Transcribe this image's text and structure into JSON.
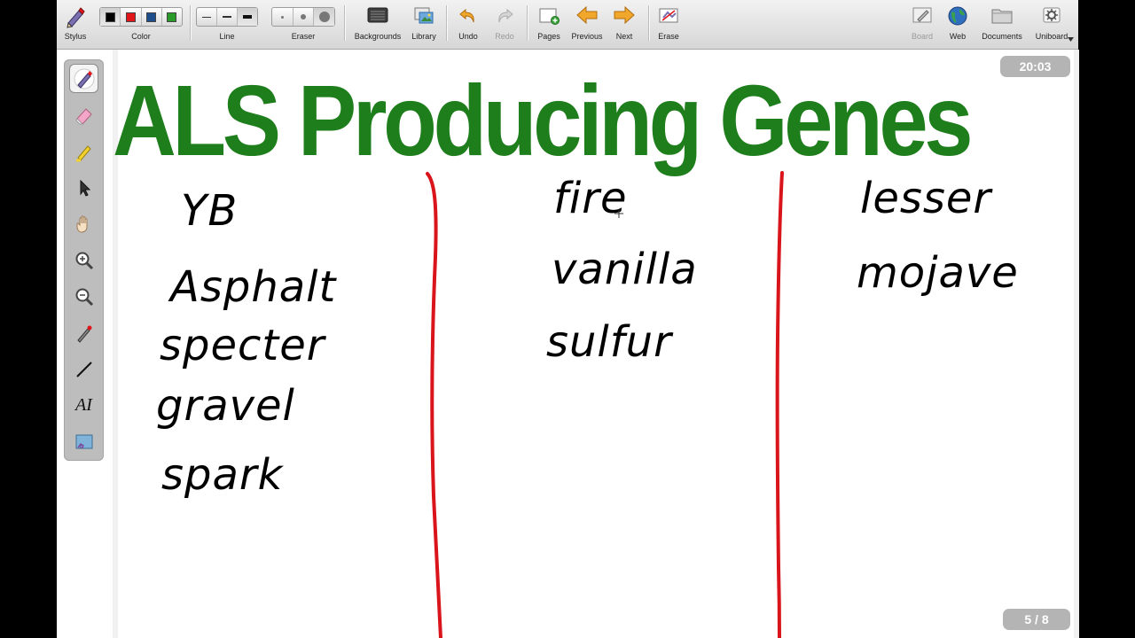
{
  "toolbar": {
    "stylus_label": "Stylus",
    "color_label": "Color",
    "line_label": "Line",
    "eraser_label": "Eraser",
    "backgrounds_label": "Backgrounds",
    "library_label": "Library",
    "undo_label": "Undo",
    "redo_label": "Redo",
    "pages_label": "Pages",
    "previous_label": "Previous",
    "next_label": "Next",
    "erase_label": "Erase",
    "board_label": "Board",
    "web_label": "Web",
    "documents_label": "Documents",
    "uniboard_label": "Uniboard",
    "colors": [
      "#000000",
      "#e0161b",
      "#1f4e8c",
      "#2a9b2a"
    ],
    "selected_color_index": 0
  },
  "board": {
    "title": "ALS Producing Genes",
    "title_color": "#1e7e1c",
    "divider_color": "#d9141a",
    "columns": [
      {
        "items": [
          "YB",
          "Asphalt",
          "specter",
          "gravel",
          "spark"
        ]
      },
      {
        "items": [
          "fire",
          "vanilla",
          "sulfur"
        ]
      },
      {
        "items": [
          "lesser",
          "mojave"
        ]
      }
    ]
  },
  "clock": "20:03",
  "page_indicator": "5 / 8",
  "toolbox": {
    "tools": [
      "pen-icon",
      "eraser-icon",
      "marker-icon",
      "selector-icon",
      "hand-icon",
      "zoom-in-icon",
      "zoom-out-icon",
      "laser-pointer-icon",
      "line-icon",
      "text-icon",
      "capture-icon"
    ],
    "text_tool_glyph": "AI"
  }
}
